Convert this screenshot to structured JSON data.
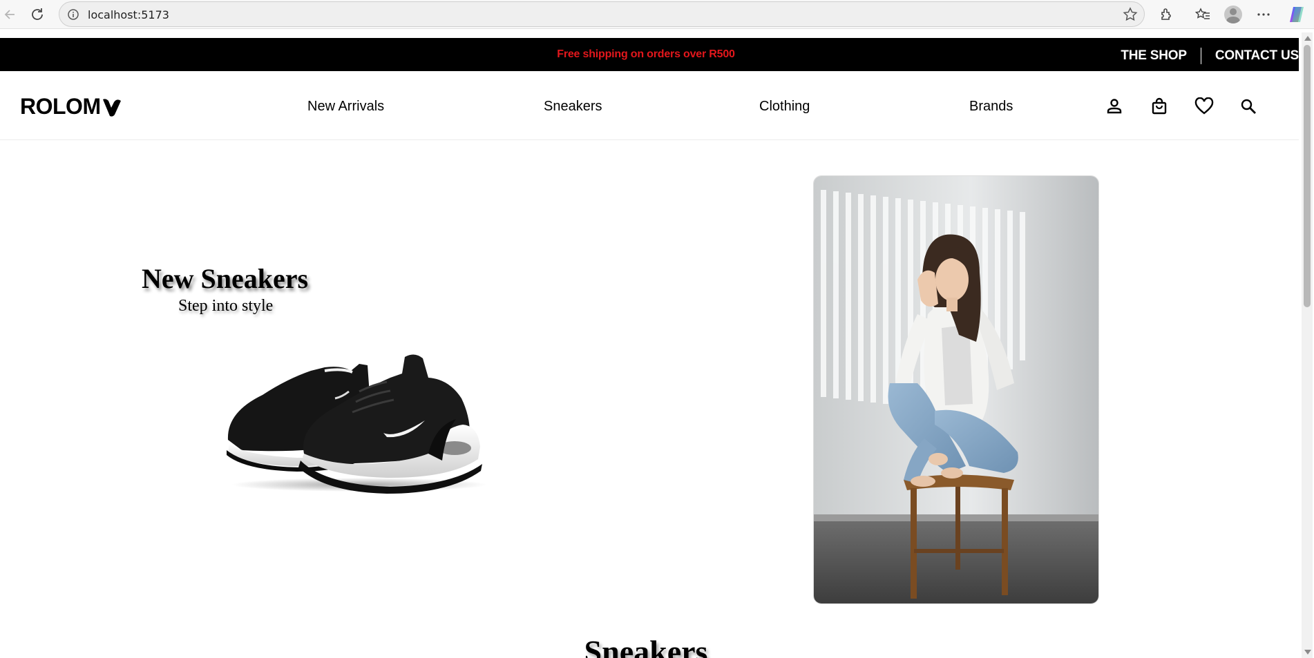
{
  "browser": {
    "url": "localhost:5173"
  },
  "announcement": {
    "message": "Free shipping on orders over R500",
    "links": [
      "THE SHOP",
      "CONTACT US"
    ]
  },
  "nav": {
    "logo_text": "ROLOM",
    "items": [
      "New Arrivals",
      "Sneakers",
      "Clothing",
      "Brands"
    ],
    "icons": [
      "account-icon",
      "shopping-bag-icon",
      "heart-icon",
      "search-icon"
    ]
  },
  "hero": {
    "title": "New Sneakers",
    "subtitle": "Step into style"
  },
  "section": {
    "title": "Sneakers"
  },
  "colors": {
    "announcement_bg": "#000000",
    "announcement_text": "#e3171c",
    "page_bg": "#ffffff"
  }
}
